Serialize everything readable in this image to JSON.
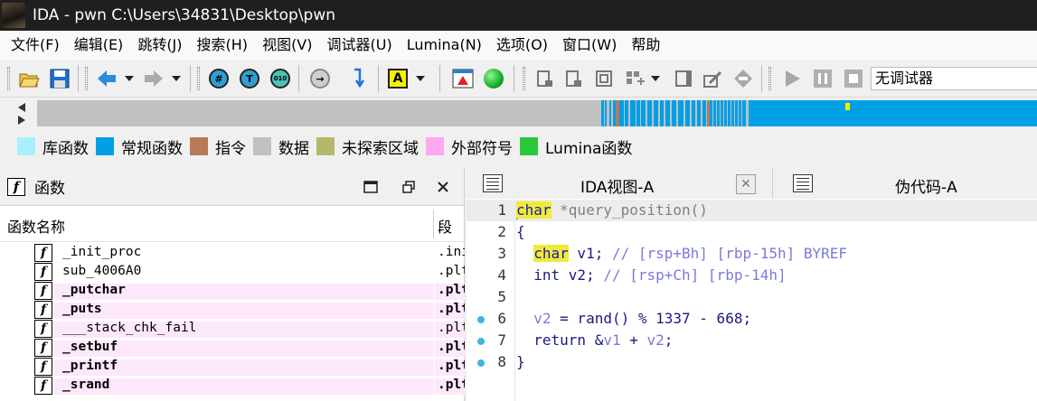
{
  "window": {
    "title": "IDA - pwn C:\\Users\\34831\\Desktop\\pwn"
  },
  "menu": [
    "文件(F)",
    "编辑(E)",
    "跳转(J)",
    "搜索(H)",
    "视图(V)",
    "调试器(U)",
    "Lumina(N)",
    "选项(O)",
    "窗口(W)",
    "帮助"
  ],
  "toolbar": {
    "debugger_select": "无调试器",
    "icons": [
      "open-folder-icon",
      "save-disk-icon",
      "nav-back-icon",
      "nav-forward-icon",
      "hash-icon",
      "text-icon",
      "hex-icon",
      "graph-icon",
      "jump-icon",
      "font-color-icon",
      "start-process-icon",
      "run-green-icon",
      "play-icon",
      "pause-icon",
      "stop-icon"
    ]
  },
  "legend": [
    {
      "label": "库函数",
      "color": "#a8f0ff"
    },
    {
      "label": "常规函数",
      "color": "#00a0e6"
    },
    {
      "label": "指令",
      "color": "#b87a5a"
    },
    {
      "label": "数据",
      "color": "#c0c0c0"
    },
    {
      "label": "未探索区域",
      "color": "#b5b86a"
    },
    {
      "label": "外部符号",
      "color": "#ffa8f0"
    },
    {
      "label": "Lumina函数",
      "color": "#2ac83c"
    }
  ],
  "functions_panel": {
    "title": "函数",
    "columns": {
      "name": "函数名称",
      "segment": "段"
    },
    "rows": [
      {
        "name": "_init_proc",
        "segment": ".init",
        "external": false
      },
      {
        "name": "sub_4006A0",
        "segment": ".plt",
        "external": false
      },
      {
        "name": "_putchar",
        "segment": ".plt",
        "external": true
      },
      {
        "name": "_puts",
        "segment": ".plt",
        "external": true
      },
      {
        "name": "___stack_chk_fail",
        "segment": ".plt",
        "external": true
      },
      {
        "name": "_setbuf",
        "segment": ".plt",
        "external": true
      },
      {
        "name": "_printf",
        "segment": ".plt",
        "external": true
      },
      {
        "name": "_srand",
        "segment": ".plt",
        "external": true
      }
    ]
  },
  "tabs": [
    {
      "label": "IDA视图-A",
      "active": true
    },
    {
      "label": "伪代码-A",
      "active": false
    }
  ],
  "code": {
    "lines": [
      {
        "num": "1",
        "text_type": "char",
        "text_rest": " *query_position()"
      },
      {
        "num": "2",
        "text": "{"
      },
      {
        "num": "3",
        "text_type": "char",
        "text_rest": " v1; ",
        "comment": "// [rsp+Bh] [rbp-15h] BYREF"
      },
      {
        "num": "4",
        "text_pre": "  int v2; ",
        "comment": "// [rsp+Ch] [rbp-14h]"
      },
      {
        "num": "5",
        "text": ""
      },
      {
        "num": "6",
        "text_a": "  v2",
        "text_b": " = rand() % 1337 - 668;"
      },
      {
        "num": "7",
        "text_a": "  return &",
        "text_b": "v1",
        "text_c": " + ",
        "text_d": "v2",
        "text_e": ";"
      },
      {
        "num": "8",
        "text": "}"
      }
    ]
  }
}
